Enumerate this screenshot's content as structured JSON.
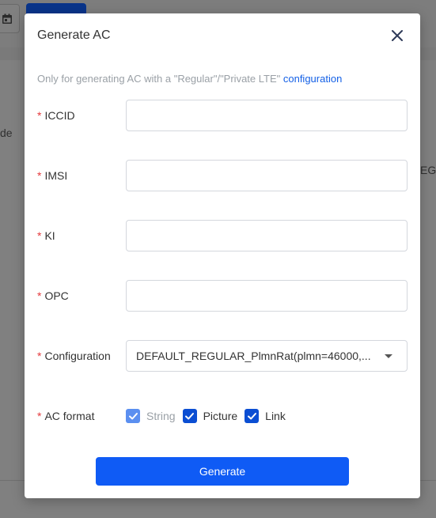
{
  "background": {
    "left_text": "de",
    "right_text": "EG"
  },
  "modal": {
    "title": "Generate AC",
    "notice_text": "Only for generating AC with a \"Regular\"/\"Private LTE\" ",
    "notice_link": "configuration",
    "required_mark": "*",
    "fields": {
      "iccid": {
        "label": "ICCID",
        "value": "",
        "placeholder": ""
      },
      "imsi": {
        "label": "IMSI",
        "value": "",
        "placeholder": ""
      },
      "ki": {
        "label": "KI",
        "value": "",
        "placeholder": ""
      },
      "opc": {
        "label": "OPC",
        "value": "",
        "placeholder": ""
      },
      "configuration": {
        "label": "Configuration",
        "value": "DEFAULT_REGULAR_PlmnRat(plmn=46000,..."
      },
      "ac_format": {
        "label": "AC format",
        "options": [
          {
            "label": "String",
            "checked": true,
            "disabled": true
          },
          {
            "label": "Picture",
            "checked": true,
            "disabled": false
          },
          {
            "label": "Link",
            "checked": true,
            "disabled": false
          }
        ]
      }
    },
    "generate_label": "Generate"
  },
  "colors": {
    "primary": "#0f5bf5",
    "checkbox": "#0b4ed3",
    "checkbox_disabled": "#5b8ff0",
    "required": "#e4393c",
    "link": "#1460e6",
    "overlay": "#808080"
  }
}
